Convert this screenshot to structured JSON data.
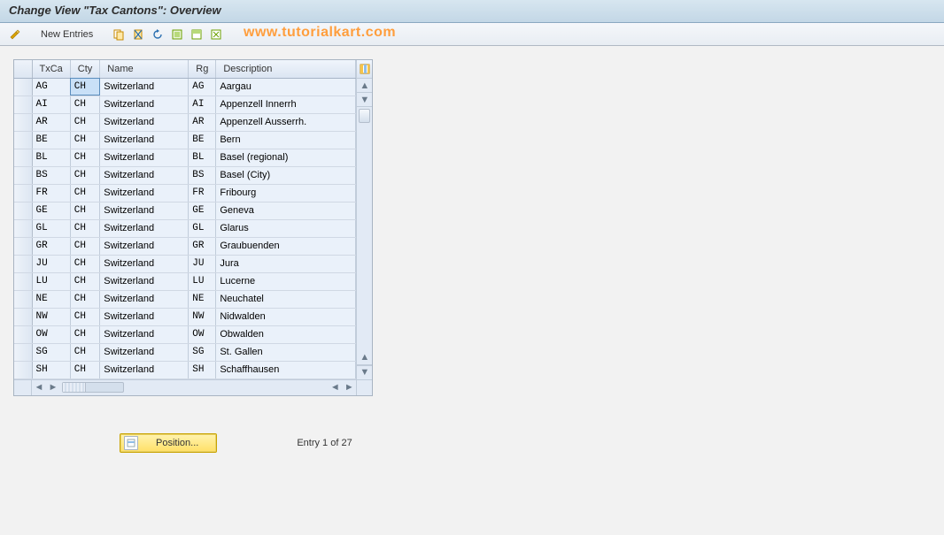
{
  "title": "Change View \"Tax Cantons\": Overview",
  "toolbar": {
    "new_entries_label": "New Entries"
  },
  "watermark": "www.tutorialkart.com",
  "table": {
    "headers": {
      "txca": "TxCa",
      "cty": "Cty",
      "name": "Name",
      "rg": "Rg",
      "desc": "Description"
    },
    "rows": [
      {
        "txca": "AG",
        "cty": "CH",
        "name": "Switzerland",
        "rg": "AG",
        "desc": "Aargau"
      },
      {
        "txca": "AI",
        "cty": "CH",
        "name": "Switzerland",
        "rg": "AI",
        "desc": "Appenzell Innerrh"
      },
      {
        "txca": "AR",
        "cty": "CH",
        "name": "Switzerland",
        "rg": "AR",
        "desc": "Appenzell Ausserrh."
      },
      {
        "txca": "BE",
        "cty": "CH",
        "name": "Switzerland",
        "rg": "BE",
        "desc": "Bern"
      },
      {
        "txca": "BL",
        "cty": "CH",
        "name": "Switzerland",
        "rg": "BL",
        "desc": "Basel (regional)"
      },
      {
        "txca": "BS",
        "cty": "CH",
        "name": "Switzerland",
        "rg": "BS",
        "desc": "Basel (City)"
      },
      {
        "txca": "FR",
        "cty": "CH",
        "name": "Switzerland",
        "rg": "FR",
        "desc": "Fribourg"
      },
      {
        "txca": "GE",
        "cty": "CH",
        "name": "Switzerland",
        "rg": "GE",
        "desc": "Geneva"
      },
      {
        "txca": "GL",
        "cty": "CH",
        "name": "Switzerland",
        "rg": "GL",
        "desc": "Glarus"
      },
      {
        "txca": "GR",
        "cty": "CH",
        "name": "Switzerland",
        "rg": "GR",
        "desc": "Graubuenden"
      },
      {
        "txca": "JU",
        "cty": "CH",
        "name": "Switzerland",
        "rg": "JU",
        "desc": "Jura"
      },
      {
        "txca": "LU",
        "cty": "CH",
        "name": "Switzerland",
        "rg": "LU",
        "desc": "Lucerne"
      },
      {
        "txca": "NE",
        "cty": "CH",
        "name": "Switzerland",
        "rg": "NE",
        "desc": "Neuchatel"
      },
      {
        "txca": "NW",
        "cty": "CH",
        "name": "Switzerland",
        "rg": "NW",
        "desc": "Nidwalden"
      },
      {
        "txca": "OW",
        "cty": "CH",
        "name": "Switzerland",
        "rg": "OW",
        "desc": "Obwalden"
      },
      {
        "txca": "SG",
        "cty": "CH",
        "name": "Switzerland",
        "rg": "SG",
        "desc": "St. Gallen"
      },
      {
        "txca": "SH",
        "cty": "CH",
        "name": "Switzerland",
        "rg": "SH",
        "desc": "Schaffhausen"
      }
    ]
  },
  "footer": {
    "position_label": "Position...",
    "entry_status": "Entry 1 of 27"
  }
}
